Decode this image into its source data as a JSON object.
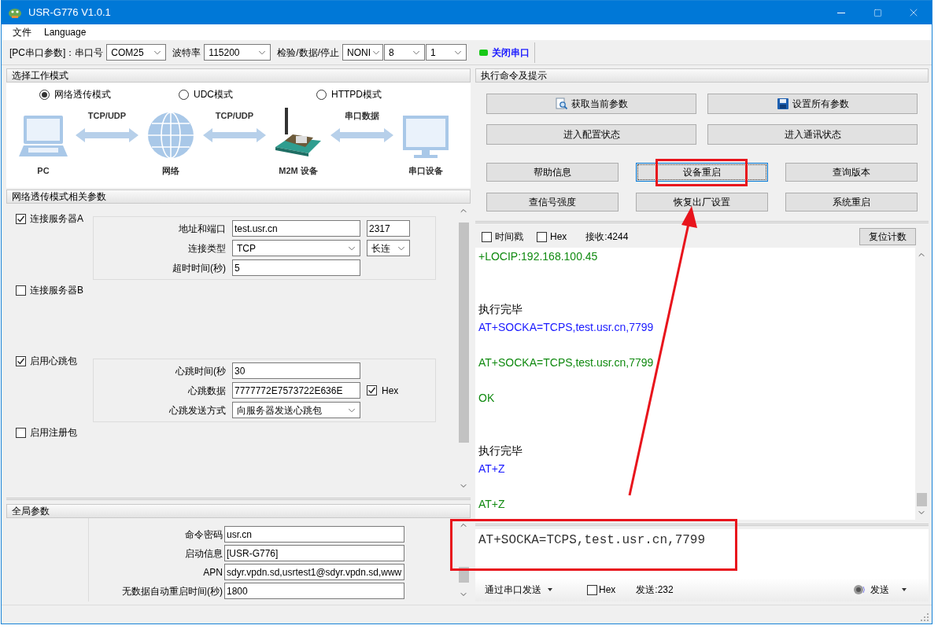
{
  "window": {
    "title": "USR-G776 V1.0.1"
  },
  "menu": [
    "文件",
    "Language"
  ],
  "serial_bar": {
    "port_label": "[PC串口参数]：串口号",
    "port": "COM25",
    "baud_label": "波特率",
    "baud": "115200",
    "format_label": "检验/数据/停止",
    "parity": "NONI",
    "data_bits": "8",
    "stop_bits": "1",
    "toggle": {
      "label": "关闭串口",
      "on": true
    }
  },
  "mode_panel": {
    "title": "选择工作模式",
    "modes": [
      {
        "label": "网络透传模式",
        "selected": true
      },
      {
        "label": "UDC模式",
        "selected": false
      },
      {
        "label": "HTTPD模式",
        "selected": false
      }
    ],
    "diagram": [
      {
        "kind": "laptop",
        "label": "PC"
      },
      {
        "kind": "link",
        "label": "TCP/UDP"
      },
      {
        "kind": "globe",
        "label": "网络"
      },
      {
        "kind": "link",
        "label": "TCP/UDP"
      },
      {
        "kind": "modem",
        "label": "M2M 设备"
      },
      {
        "kind": "link",
        "label": "串口数据"
      },
      {
        "kind": "monitor",
        "label": "串口设备"
      }
    ]
  },
  "params_panel": {
    "title": "网络透传模式相关参数",
    "sections": [
      {
        "label": "连接服务器A",
        "checked": true,
        "fields": [
          {
            "label": "地址和端口",
            "kind": "text",
            "value": "test.usr.cn",
            "extra": {
              "kind": "text",
              "value": "2317"
            }
          },
          {
            "label": "连接类型",
            "kind": "select",
            "value": "TCP",
            "extra": {
              "kind": "select",
              "value": "长连"
            }
          },
          {
            "label": "超时时间(秒)",
            "kind": "text",
            "value": "5"
          }
        ]
      },
      {
        "label": "连接服务器B",
        "checked": false
      },
      {
        "label": "启用心跳包",
        "checked": true,
        "fields": [
          {
            "label": "心跳时间(秒",
            "kind": "text",
            "value": "30"
          },
          {
            "label": "心跳数据",
            "kind": "text",
            "value": "7777772E7573722E636E",
            "extra": {
              "kind": "check",
              "label": "Hex",
              "checked": true
            }
          },
          {
            "label": "心跳发送方式",
            "kind": "select",
            "value": "向服务器发送心跳包"
          }
        ]
      },
      {
        "label": "启用注册包",
        "checked": false
      }
    ]
  },
  "global_panel": {
    "title": "全局参数",
    "fields": [
      {
        "label": "命令密码",
        "value": "usr.cn"
      },
      {
        "label": "启动信息",
        "value": "[USR-G776]"
      },
      {
        "label": "APN",
        "value": "sdyr.vpdn.sd,usrtest1@sdyr.vpdn.sd,www"
      },
      {
        "label": "无数据自动重启时间(秒)",
        "value": "1800"
      }
    ]
  },
  "command_panel": {
    "title": "执行命令及提示",
    "wide_buttons": [
      {
        "label": "获取当前参数"
      },
      {
        "label": "设置所有参数"
      },
      {
        "label": "进入配置状态"
      },
      {
        "label": "进入通讯状态"
      }
    ],
    "buttons": [
      {
        "label": "帮助信息",
        "focused": false
      },
      {
        "label": "设备重启",
        "focused": true
      },
      {
        "label": "查询版本",
        "focused": false
      },
      {
        "label": "查信号强度",
        "focused": false
      },
      {
        "label": "恢复出厂设置",
        "focused": false
      },
      {
        "label": "系统重启",
        "focused": false
      }
    ]
  },
  "receive_bar": {
    "timestamp": {
      "label": "时间戳",
      "checked": false
    },
    "hex": {
      "label": "Hex",
      "checked": false
    },
    "count": "接收:4244",
    "reset_button": "复位计数"
  },
  "log": [
    {
      "kind": "rx",
      "text": "+LOCIP:192.168.100.45"
    },
    {
      "kind": "info",
      "text": "执行完毕"
    },
    {
      "kind": "tx",
      "text": "AT+SOCKA=TCPS,test.usr.cn,7799"
    },
    {
      "kind": "rx",
      "text": "AT+SOCKA=TCPS,test.usr.cn,7799"
    },
    {
      "kind": "rx",
      "text": "OK"
    },
    {
      "kind": "info",
      "text": "执行完毕"
    },
    {
      "kind": "tx",
      "text": "AT+Z"
    },
    {
      "kind": "rx",
      "text": "AT+Z"
    }
  ],
  "send_input": {
    "value": "AT+SOCKA=TCPS,test.usr.cn,7799"
  },
  "send_bar": {
    "channel": "通过串口发送",
    "hex": {
      "label": "Hex",
      "checked": false
    },
    "count": "发送:232",
    "send_button": "发送"
  }
}
